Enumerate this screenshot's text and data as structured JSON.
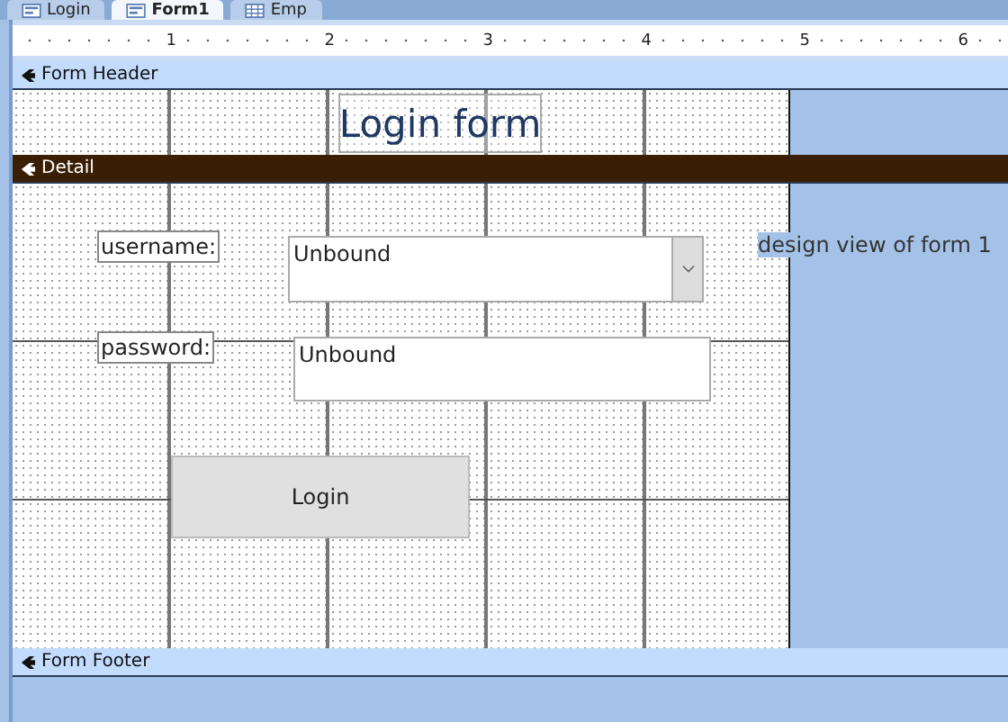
{
  "tabs": [
    {
      "label": "Login",
      "kind": "form",
      "selected": false
    },
    {
      "label": "Form1",
      "kind": "form",
      "selected": true
    },
    {
      "label": "Emp",
      "kind": "table",
      "selected": false
    }
  ],
  "ruler": [
    "1",
    "2",
    "3",
    "4",
    "5",
    "6"
  ],
  "form_header": {
    "title": "Form Header",
    "controls": [
      {
        "kind": "title",
        "text": "Login form"
      }
    ]
  },
  "detail": {
    "title": "Detail",
    "controls": [
      {
        "kind": "label",
        "text": "username:"
      },
      {
        "kind": "combo",
        "text": "Unbound"
      },
      {
        "kind": "label",
        "text": "password:"
      },
      {
        "kind": "textbox",
        "text": "Unbound"
      },
      {
        "kind": "button",
        "text": "Login"
      },
      {
        "kind": "note",
        "text": "design view of form 1"
      }
    ]
  },
  "form_footer": {
    "title": "Form Footer"
  }
}
